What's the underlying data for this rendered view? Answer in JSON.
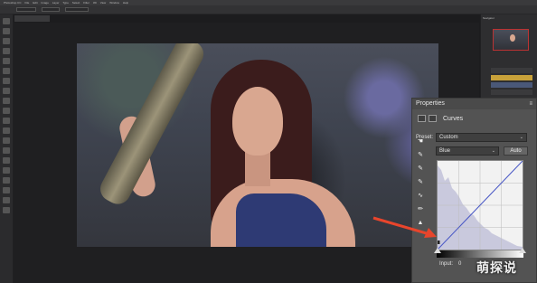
{
  "app": {
    "menu": [
      "Photoshop CC",
      "File",
      "Edit",
      "Image",
      "Layer",
      "Type",
      "Select",
      "Filter",
      "3D",
      "View",
      "Window",
      "Help"
    ]
  },
  "document": {
    "tab_label": ""
  },
  "navigator": {
    "title": "Navigator"
  },
  "layers": {
    "rows": [
      "",
      "",
      "",
      ""
    ]
  },
  "properties": {
    "title": "Properties",
    "adjustment_label": "Curves",
    "preset_label": "Preset:",
    "preset_value": "Custom",
    "channel_value": "Blue",
    "auto_label": "Auto",
    "input_label": "Input:",
    "input_value": "0"
  },
  "curve": {
    "channel_color": "#4a59c8",
    "histogram_fill": "#c9c9dd",
    "arrow_color": "#e8452c"
  },
  "watermark": {
    "text": "萌探说"
  }
}
